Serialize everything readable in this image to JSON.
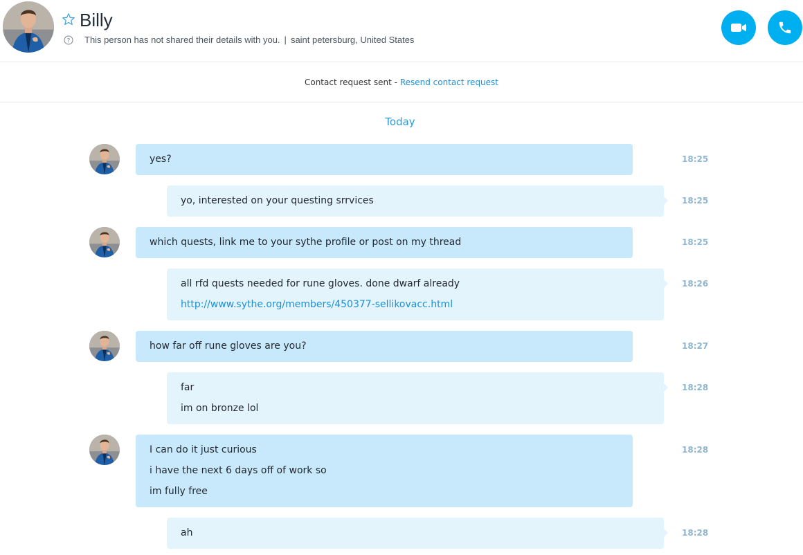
{
  "contact": {
    "name": "Billy",
    "subtitle_details": "This person has not shared their details with you.",
    "subtitle_separator": "|",
    "subtitle_location": "saint petersburg, United States"
  },
  "request": {
    "status_text": "Contact request sent - ",
    "resend_link": "Resend contact request"
  },
  "day_label": "Today",
  "colors": {
    "accent": "#00aff0",
    "incoming_bubble": "#c7e9fb",
    "outgoing_bubble": "#e3f4fd",
    "link": "#1d8fd4",
    "time": "#8fb6cf"
  },
  "icons": {
    "favorite": "star-outline-icon",
    "help": "question-circle-icon",
    "video_call": "video-camera-icon",
    "audio_call": "phone-icon"
  },
  "messages": [
    {
      "direction": "in",
      "lines": [
        "yes?"
      ],
      "time": "18:25"
    },
    {
      "direction": "out",
      "lines": [
        "yo, interested on your questing srrvices"
      ],
      "time": "18:25"
    },
    {
      "direction": "in",
      "lines": [
        "which quests, link me to your sythe profile or post on my thread"
      ],
      "time": "18:25"
    },
    {
      "direction": "out",
      "lines": [
        "all rfd quests needed for rune gloves. done dwarf already",
        "http://www.sythe.org/members/450377-sellikovacc.html"
      ],
      "time": "18:26"
    },
    {
      "direction": "in",
      "lines": [
        "how far off rune gloves are you?"
      ],
      "time": "18:27"
    },
    {
      "direction": "out",
      "lines": [
        "far",
        "im on bronze lol"
      ],
      "time": "18:28"
    },
    {
      "direction": "in",
      "lines": [
        "I can do it just curious",
        "i have the next 6 days off of work so",
        "im fully free"
      ],
      "time": "18:28"
    },
    {
      "direction": "out",
      "lines": [
        "ah"
      ],
      "time": "18:28"
    }
  ]
}
